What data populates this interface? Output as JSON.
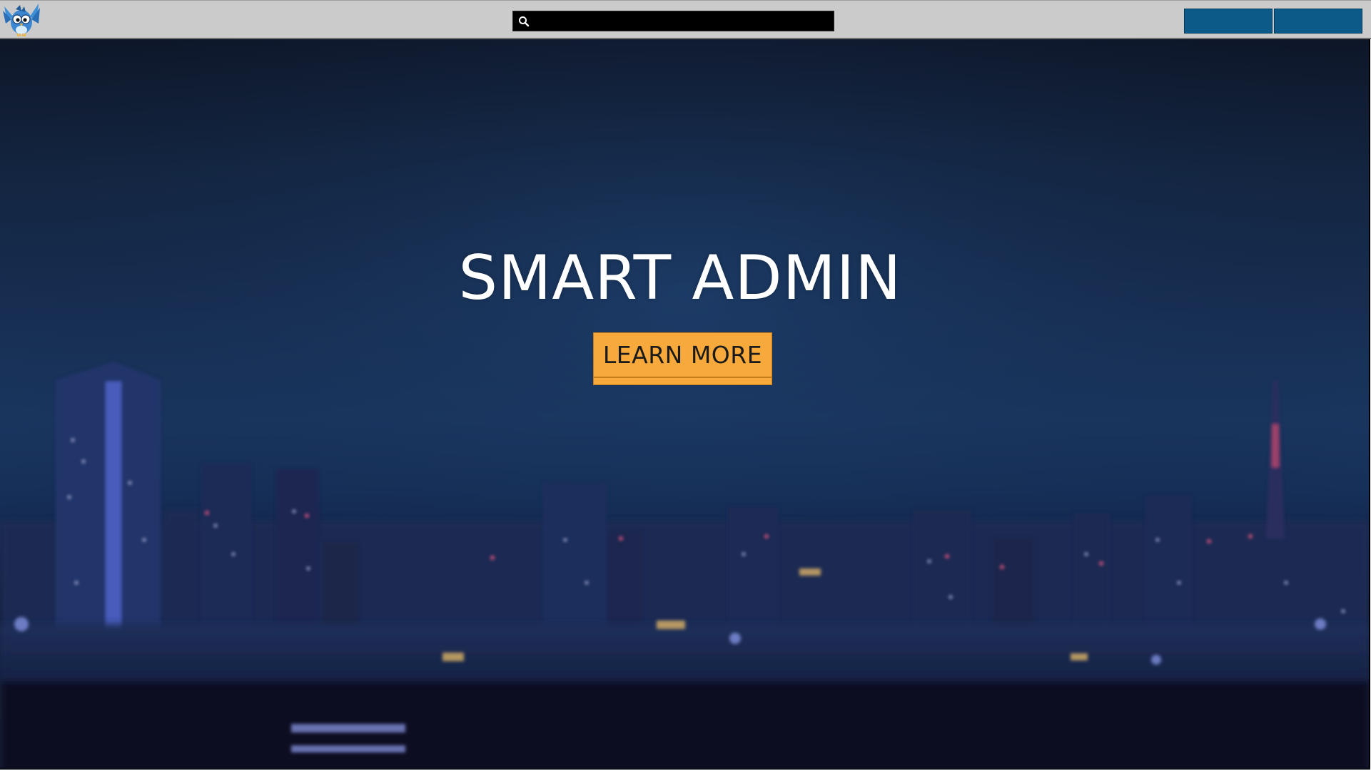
{
  "header": {
    "search": {
      "value": "",
      "placeholder": ""
    },
    "nav_buttons": [
      {
        "label": ""
      },
      {
        "label": ""
      }
    ]
  },
  "hero": {
    "title": "SMART ADMIN",
    "cta_label": "LEARN MORE"
  },
  "colors": {
    "topbar": "#cbcbcb",
    "nav_button": "#0c5a88",
    "cta": "#f8a93c",
    "search_box": "#000000"
  },
  "icons": [
    "bird-logo",
    "search-icon"
  ]
}
